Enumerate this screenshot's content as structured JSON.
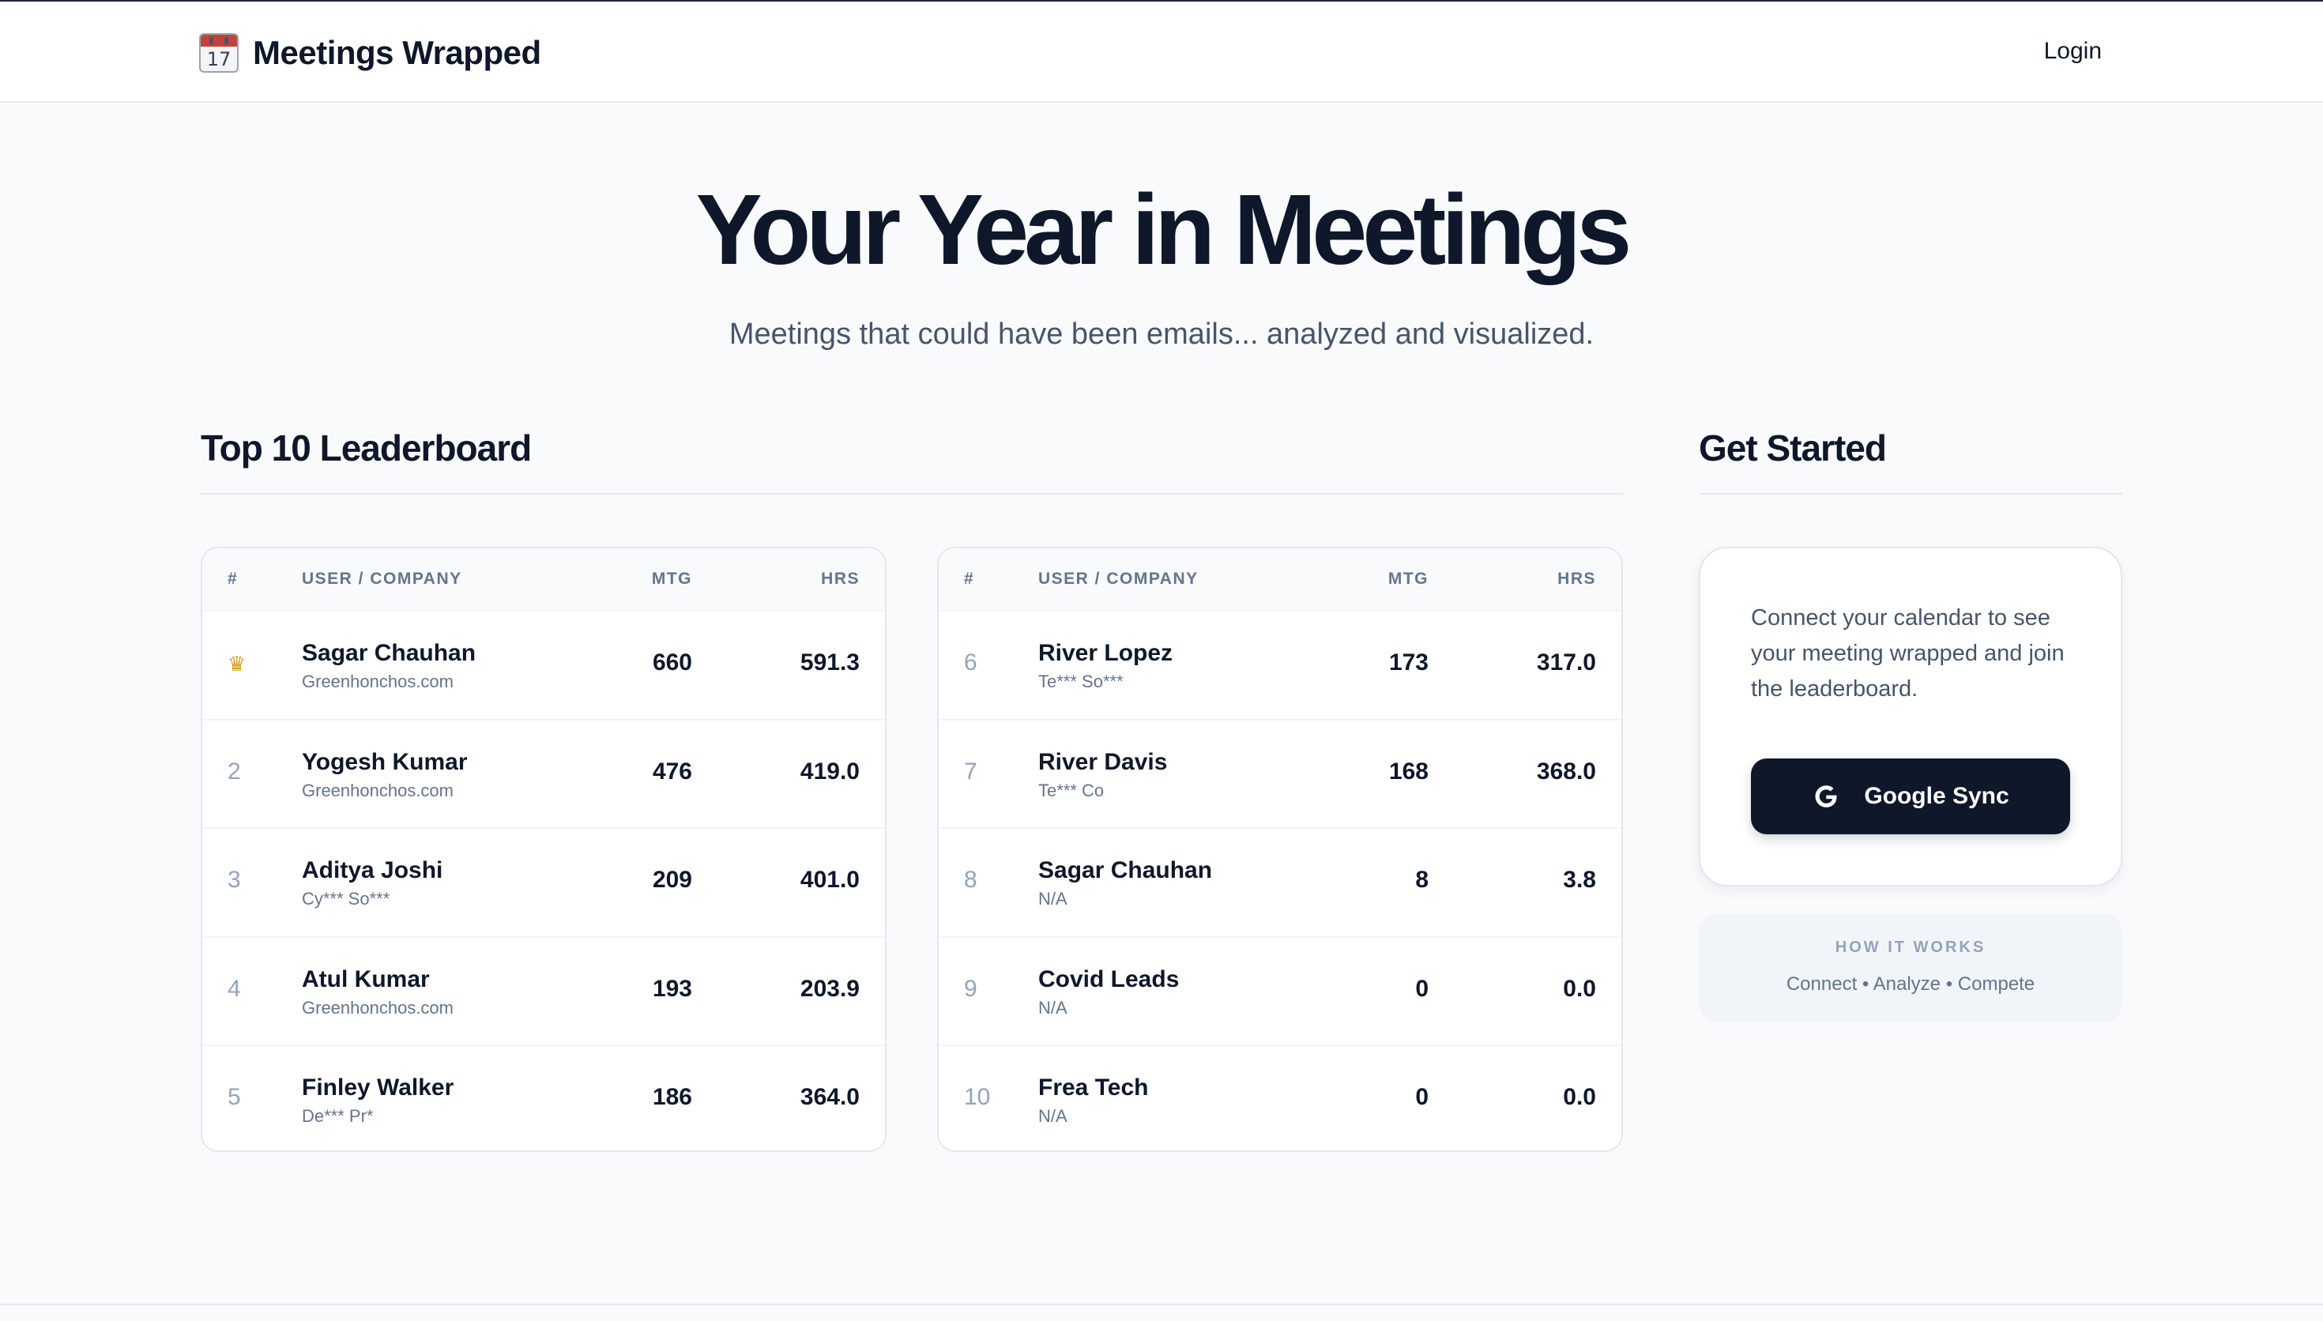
{
  "header": {
    "brand_icon": "calendar-icon",
    "brand_icon_day": "17",
    "brand_name": "Meetings Wrapped",
    "login_label": "Login"
  },
  "hero": {
    "title": "Your Year in Meetings",
    "subtitle": "Meetings that could have been emails... analyzed and visualized."
  },
  "leaderboard": {
    "title": "Top 10 Leaderboard",
    "columns": {
      "rank": "#",
      "user": "USER / COMPANY",
      "mtg": "MTG",
      "hrs": "HRS"
    },
    "top_icon": "crown-icon",
    "rows": [
      {
        "rank": "1",
        "name": "Sagar Chauhan",
        "company": "Greenhonchos.com",
        "mtg": "660",
        "hrs": "591.3"
      },
      {
        "rank": "2",
        "name": "Yogesh Kumar",
        "company": "Greenhonchos.com",
        "mtg": "476",
        "hrs": "419.0"
      },
      {
        "rank": "3",
        "name": "Aditya Joshi",
        "company": "Cy*** So***",
        "mtg": "209",
        "hrs": "401.0"
      },
      {
        "rank": "4",
        "name": "Atul Kumar",
        "company": "Greenhonchos.com",
        "mtg": "193",
        "hrs": "203.9"
      },
      {
        "rank": "5",
        "name": "Finley Walker",
        "company": "De*** Pr*",
        "mtg": "186",
        "hrs": "364.0"
      },
      {
        "rank": "6",
        "name": "River Lopez",
        "company": "Te*** So***",
        "mtg": "173",
        "hrs": "317.0"
      },
      {
        "rank": "7",
        "name": "River Davis",
        "company": "Te*** Co",
        "mtg": "168",
        "hrs": "368.0"
      },
      {
        "rank": "8",
        "name": "Sagar Chauhan",
        "company": "N/A",
        "mtg": "8",
        "hrs": "3.8"
      },
      {
        "rank": "9",
        "name": "Covid Leads",
        "company": "N/A",
        "mtg": "0",
        "hrs": "0.0"
      },
      {
        "rank": "10",
        "name": "Frea Tech",
        "company": "N/A",
        "mtg": "0",
        "hrs": "0.0"
      }
    ]
  },
  "get_started": {
    "title": "Get Started",
    "description": "Connect your calendar to see your meeting wrapped and join the leaderboard.",
    "button_label": "Google Sync",
    "button_icon": "google-icon",
    "how_it_works_title": "HOW IT WORKS",
    "how_it_works_steps": "Connect • Analyze • Compete"
  },
  "colors": {
    "background": "#f8fafc",
    "text_primary": "#0f172a",
    "text_muted": "#64748b",
    "button_bg": "#0f172a",
    "crown": "#d4a017"
  }
}
